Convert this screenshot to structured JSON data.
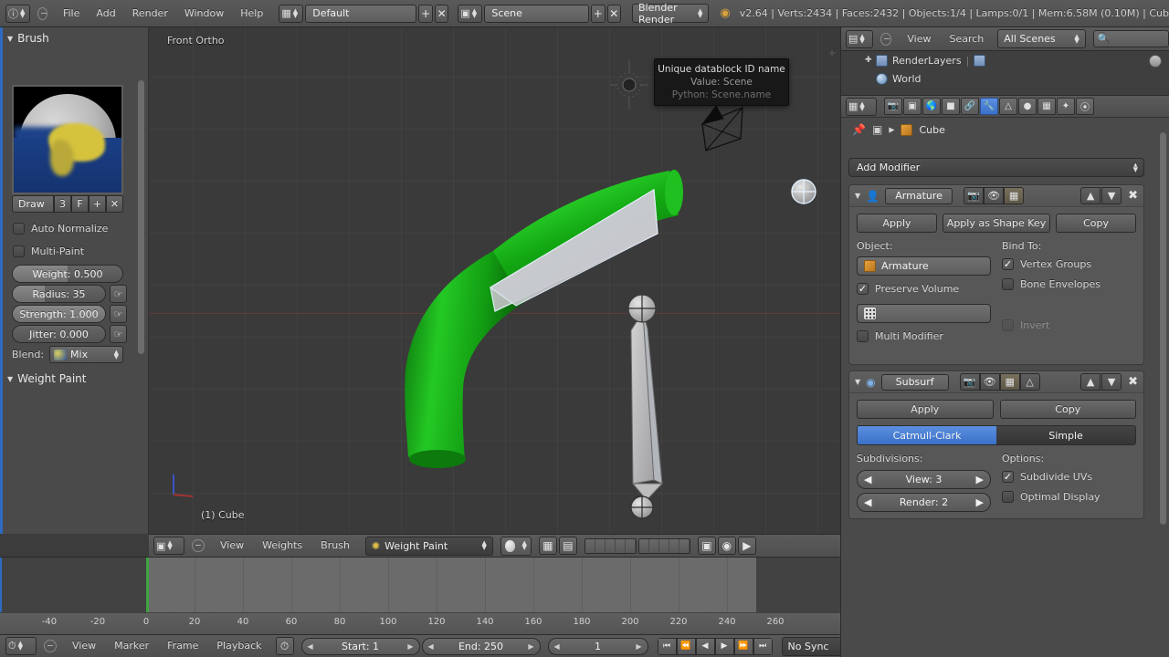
{
  "topbar": {
    "menus": [
      "File",
      "Add",
      "Render",
      "Window",
      "Help"
    ],
    "screen_layout": "Default",
    "scene_name": "Scene",
    "engine": "Blender Render",
    "status": "v2.64 | Verts:2434 | Faces:2432 | Objects:1/4 | Lamps:0/1 | Mem:6.58M (0.10M) | Cub",
    "add_label": "+",
    "close_label": "✕"
  },
  "toolshelf": {
    "brush_panel_title": "Brush",
    "brush_name": "Draw",
    "brush_users": "3",
    "brush_fake_user": "F",
    "brush_add": "+",
    "brush_unlink": "✕",
    "auto_normalize": "Auto Normalize",
    "multi_paint": "Multi-Paint",
    "weight": "Weight: 0.500",
    "radius": "Radius: 35",
    "strength": "Strength: 1.000",
    "jitter": "Jitter: 0.000",
    "blend_label": "Blend:",
    "blend_value": "Mix",
    "weight_paint_panel_title": "Weight Paint"
  },
  "viewport": {
    "view_label": "Front Ortho",
    "object_label": "(1) Cube",
    "tooltip": {
      "line1": "Unique datablock ID name",
      "line2": "Value: Scene",
      "line3": "Python: Scene.name"
    },
    "footer": {
      "menus": [
        "View",
        "Weights",
        "Brush"
      ],
      "mode": "Weight Paint"
    }
  },
  "outliner": {
    "menus": [
      "View",
      "Search"
    ],
    "scope": "All Scenes",
    "search_placeholder": "",
    "items": [
      {
        "label": "RenderLayers"
      },
      {
        "label": "World"
      }
    ]
  },
  "properties": {
    "breadcrumb_object": "Cube",
    "add_modifier": "Add Modifier",
    "modifiers": [
      {
        "name": "Armature",
        "apply": "Apply",
        "apply_shape_key": "Apply as Shape Key",
        "copy": "Copy",
        "object_label": "Object:",
        "object_value": "Armature",
        "bind_to_label": "Bind To:",
        "vertex_groups": "Vertex Groups",
        "vertex_groups_checked": true,
        "bone_envelopes": "Bone Envelopes",
        "bone_envelopes_checked": false,
        "preserve_volume": "Preserve Volume",
        "preserve_volume_checked": true,
        "vertex_group_value": "",
        "invert": "Invert",
        "invert_checked": false,
        "invert_disabled": true,
        "multi_modifier": "Multi Modifier",
        "multi_modifier_checked": false
      },
      {
        "name": "Subsurf",
        "apply": "Apply",
        "copy": "Copy",
        "type_options": [
          "Catmull-Clark",
          "Simple"
        ],
        "type_active": "Catmull-Clark",
        "subdivisions_label": "Subdivisions:",
        "view": "View: 3",
        "render": "Render: 2",
        "options_label": "Options:",
        "subdivide_uvs": "Subdivide UVs",
        "subdivide_uvs_checked": true,
        "optimal_display": "Optimal Display",
        "optimal_display_checked": false
      }
    ]
  },
  "timeline": {
    "ruler_ticks": [
      "-40",
      "-20",
      "0",
      "20",
      "40",
      "60",
      "80",
      "100",
      "120",
      "140",
      "160",
      "180",
      "200",
      "220",
      "240",
      "260"
    ],
    "menus": [
      "View",
      "Marker",
      "Frame",
      "Playback"
    ],
    "start": "Start: 1",
    "end": "End: 250",
    "current_frame": "1",
    "sync_mode": "No Sync"
  },
  "colors": {
    "accent_blue": "#3a70c8",
    "playhead_green": "#3fa33f",
    "weight_green": "#1aa31a",
    "header_gray": "#545454",
    "panel_gray": "#4a4a4a"
  }
}
